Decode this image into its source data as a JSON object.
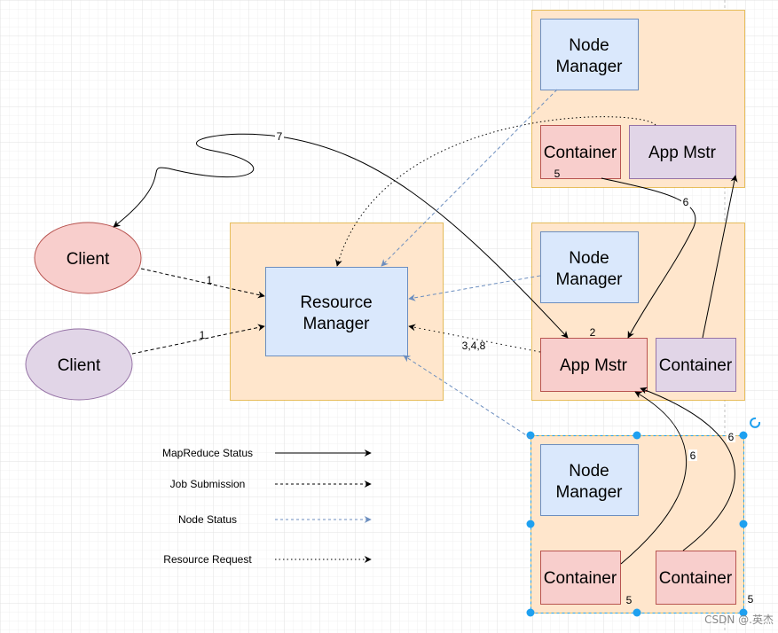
{
  "colors": {
    "group_fill": "#ffe6cc",
    "group_stroke": "#d79b00",
    "blue_fill": "#dae8fc",
    "blue_stroke": "#6c8ebf",
    "red_fill": "#f8cecc",
    "red_stroke": "#b85450",
    "purple_fill": "#e1d5e7",
    "purple_stroke": "#9673a6",
    "selection": "#1ea0f0"
  },
  "resource_manager": {
    "line1": "Resource",
    "line2": "Manager"
  },
  "clients": [
    {
      "label": "Client"
    },
    {
      "label": "Client"
    }
  ],
  "nodes": [
    {
      "node_manager": {
        "line1": "Node",
        "line2": "Manager"
      },
      "left": "Container",
      "right": "App Mstr"
    },
    {
      "node_manager": {
        "line1": "Node",
        "line2": "Manager"
      },
      "left": "App Mstr",
      "right": "Container"
    },
    {
      "node_manager": {
        "line1": "Node",
        "line2": "Manager"
      },
      "left": "Container",
      "right": "Container"
    }
  ],
  "edge_labels": {
    "e7": "7",
    "e5a": "5",
    "e6a": "6",
    "e2": "2",
    "e348": "3,4,8",
    "e1a": "1",
    "e1b": "1",
    "e6b": "6",
    "e6c": "6",
    "e5b": "5",
    "e5c": "5"
  },
  "legend": [
    {
      "label": "MapReduce Status",
      "style": "solid"
    },
    {
      "label": "Job Submission",
      "style": "dashed"
    },
    {
      "label": "Node Status",
      "style": "dashed-blue"
    },
    {
      "label": "Resource Request",
      "style": "dotted"
    }
  ],
  "watermark": "CSDN @.英杰"
}
